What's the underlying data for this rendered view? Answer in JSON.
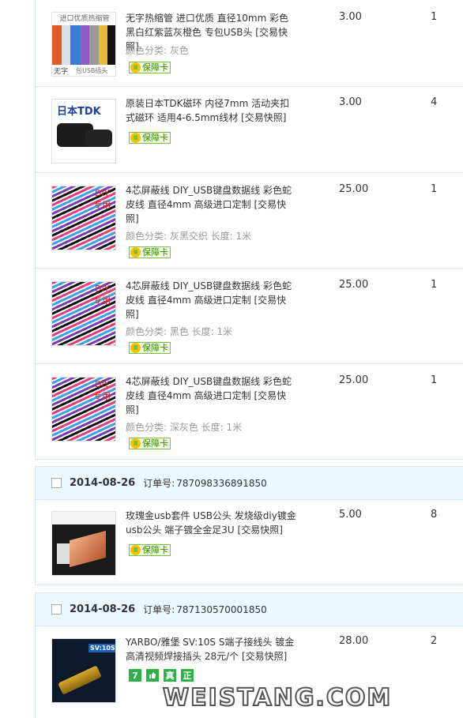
{
  "orders": [
    {
      "items": [
        {
          "title": "无字热缩管 进口优质 直径10mm 彩色黑白红紫蓝灰橙色 专包USB头 [交易快照]",
          "spec": "颜色分类: 灰色",
          "guard": "保障卡",
          "price": "3.00",
          "qty": "1",
          "thumb_texts": {
            "top": "进口优质热缩管",
            "bl": "无字",
            "br": "包USB插头"
          }
        },
        {
          "title": "原装日本TDK磁环 内径7mm 活动夹扣式磁环 适用4-6.5mm线材 [交易快照]",
          "spec": "",
          "guard": "保障卡",
          "price": "3.00",
          "qty": "4",
          "thumb_texts": {
            "top": "日本TDK"
          }
        },
        {
          "title": "4芯屏蔽线 DIY_USB键盘数据线 彩色蛇皮线 直径4mm 高级进口定制 [交易快照]",
          "spec": "颜色分类: 灰黑交织  长度: 1米",
          "guard": "保障卡",
          "price": "25.00",
          "qty": "1",
          "thumb_texts": {
            "a": "DIY",
            "b": "专用"
          }
        },
        {
          "title": "4芯屏蔽线 DIY_USB键盘数据线 彩色蛇皮线 直径4mm 高级进口定制 [交易快照]",
          "spec": "颜色分类: 黑色  长度: 1米",
          "guard": "保障卡",
          "price": "25.00",
          "qty": "1",
          "thumb_texts": {
            "a": "DIY",
            "b": "专用"
          }
        },
        {
          "title": "4芯屏蔽线 DIY_USB键盘数据线 彩色蛇皮线 直径4mm 高级进口定制 [交易快照]",
          "spec": "颜色分类: 深灰色  长度: 1米",
          "guard": "保障卡",
          "price": "25.00",
          "qty": "1",
          "thumb_texts": {
            "a": "DIY",
            "b": "专用"
          }
        }
      ]
    },
    {
      "date": "2014-08-26",
      "order_label": "订单号:",
      "order_no": "787098336891850",
      "items": [
        {
          "title": "玫瑰金usb套件 USB公头 发烧级diy镀金usb公头 端子镀全金足3U [交易快照]",
          "guard": "保障卡",
          "price": "5.00",
          "qty": "8"
        }
      ]
    },
    {
      "date": "2014-08-26",
      "order_label": "订单号:",
      "order_no": "787130570001850",
      "items": [
        {
          "title": "YARBO/雅堡 SV:10S S端子接线头 镀金高清视频焊接插头 28元/个 [交易快照]",
          "price": "28.00",
          "qty": "2",
          "thumb_texts": {
            "sv": "SV:10S"
          },
          "service_icons": [
            {
              "name": "seven-day-icon",
              "glyph": "7",
              "color": "#2fb14a"
            },
            {
              "name": "thumb-up-icon",
              "glyph": "",
              "color": "#2fb14a"
            },
            {
              "name": "genuine-icon",
              "glyph": "真",
              "color": "#2fb14a"
            },
            {
              "name": "authentic-icon",
              "glyph": "正",
              "color": "#2fb14a"
            }
          ]
        }
      ]
    }
  ],
  "watermark": "WEISTANG.COM"
}
